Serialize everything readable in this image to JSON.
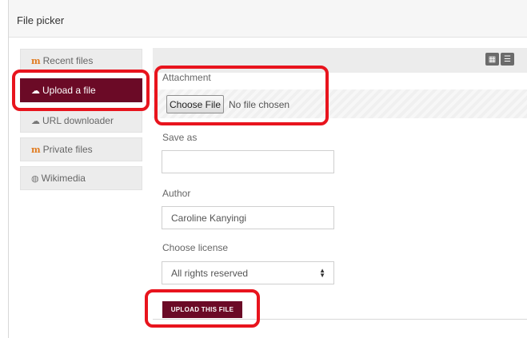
{
  "header": {
    "title": "File picker"
  },
  "sidebar": {
    "items": [
      {
        "label": "Recent files",
        "icon": "moodle-icon",
        "active": false
      },
      {
        "label": "Upload a file",
        "icon": "upload-icon",
        "active": true
      },
      {
        "label": "URL downloader",
        "icon": "url-download-icon",
        "active": false
      },
      {
        "label": "Private files",
        "icon": "moodle-icon",
        "active": false
      },
      {
        "label": "Wikimedia",
        "icon": "wikimedia-icon",
        "active": false
      }
    ]
  },
  "view_buttons": {
    "grid_icon": "grid-view-icon",
    "list_icon": "list-view-icon"
  },
  "form": {
    "attachment_label": "Attachment",
    "choose_file_label": "Choose File",
    "file_status": "No file chosen",
    "save_as_label": "Save as",
    "save_as_value": "",
    "author_label": "Author",
    "author_value": "Caroline Kanyingi",
    "license_label": "Choose license",
    "license_value": "All rights reserved",
    "upload_button": "UPLOAD THIS FILE"
  },
  "colors": {
    "accent": "#6b0a26",
    "highlight": "#e8141d"
  }
}
